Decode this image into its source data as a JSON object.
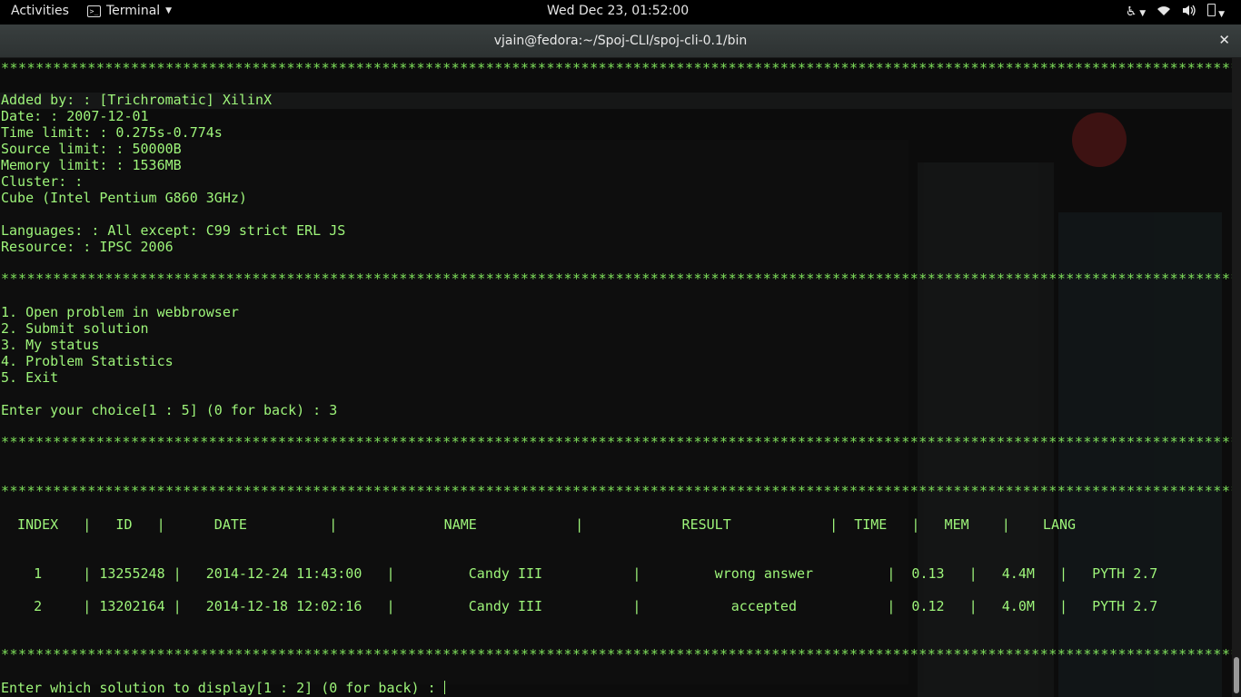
{
  "topbar": {
    "activities": "Activities",
    "app_name": "Terminal",
    "clock": "Wed Dec 23, 01:52:00"
  },
  "window": {
    "title": "vjain@fedora:~/Spoj-CLI/spoj-cli-0.1/bin"
  },
  "terminal": {
    "separator": "*************************************************************************************************************************************************************************",
    "info": {
      "added_by": "Added by: : [Trichromatic] XilinX",
      "date": "Date: : 2007-12-01",
      "time_limit": "Time limit: : 0.275s-0.774s",
      "source_limit": "Source limit: : 50000B",
      "memory_limit": "Memory limit: : 1536MB",
      "cluster": "Cluster: :",
      "cube": "Cube (Intel Pentium G860 3GHz)",
      "languages": "Languages: : All except: C99 strict ERL JS",
      "resource": "Resource: : IPSC 2006"
    },
    "menu": [
      "1. Open problem in webbrowser",
      "2. Submit solution",
      "3. My status",
      "4. Problem Statistics",
      "5. Exit"
    ],
    "choice_prompt": "Enter your choice[1 : 5] (0 for back) : 3",
    "table": {
      "header": "  INDEX   |   ID   |      DATE          |             NAME            |            RESULT            |  TIME   |   MEM    |    LANG",
      "rows": [
        "    1     | 13255248 |   2014-12-24 11:43:00   |         Candy III           |         wrong answer         |  0.13   |   4.4M   |   PYTH 2.7",
        "    2     | 13202164 |   2014-12-18 12:02:16   |         Candy III           |           accepted           |  0.12   |   4.0M   |   PYTH 2.7"
      ]
    },
    "final_prompt": "Enter which solution to display[1 : 2] (0 for back) : "
  }
}
